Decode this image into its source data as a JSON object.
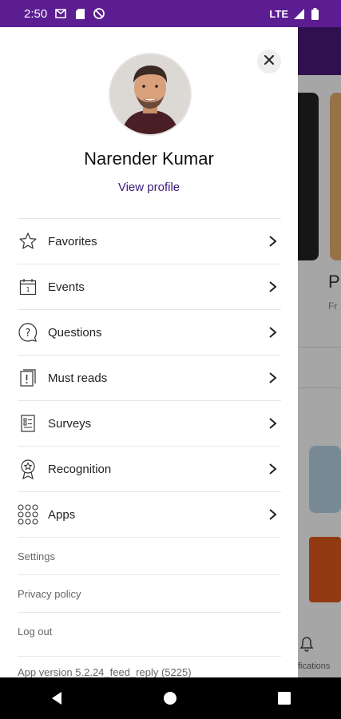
{
  "status_bar": {
    "time": "2:50",
    "network": "LTE",
    "icons": [
      "gmail-icon",
      "sd-card-icon",
      "do-not-disturb-icon",
      "signal-icon",
      "battery-icon"
    ]
  },
  "drawer": {
    "close_icon": "close-icon",
    "user_name": "Narender Kumar",
    "view_profile": "View profile",
    "menu_items": [
      {
        "label": "Favorites",
        "icon": "star-icon"
      },
      {
        "label": "Events",
        "icon": "calendar-icon"
      },
      {
        "label": "Questions",
        "icon": "question-icon"
      },
      {
        "label": "Must reads",
        "icon": "must-read-icon"
      },
      {
        "label": "Surveys",
        "icon": "survey-icon"
      },
      {
        "label": "Recognition",
        "icon": "award-icon"
      },
      {
        "label": "Apps",
        "icon": "apps-grid-icon"
      }
    ],
    "secondary_items": [
      {
        "label": "Settings"
      },
      {
        "label": "Privacy policy"
      },
      {
        "label": "Log out"
      }
    ],
    "app_version": "App version 5.2.24_feed_reply (5225)"
  },
  "background": {
    "partial_title": "Pl",
    "partial_subtitle": "Fr",
    "partial_tab": "fications"
  },
  "colors": {
    "brand_purple": "#5b1d91",
    "link_purple": "#3a1a7a"
  }
}
